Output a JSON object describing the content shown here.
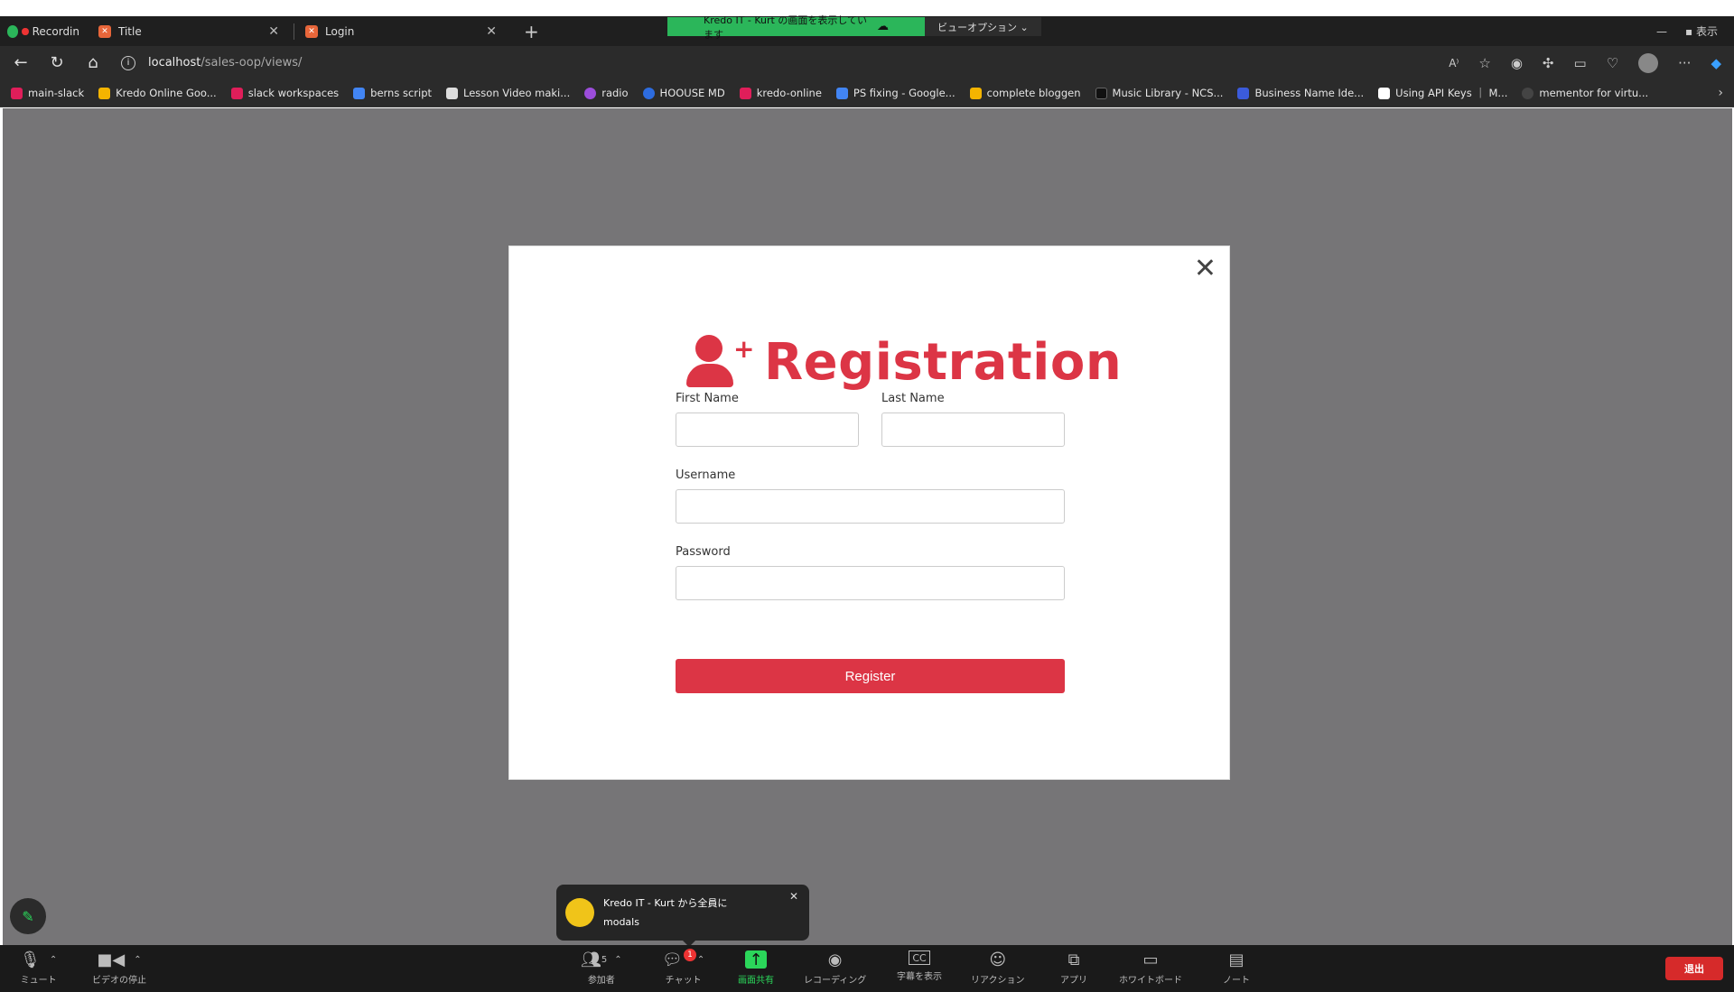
{
  "share_banner": {
    "message": "Kredo IT - Kurt の画面を表示しています",
    "view_options": "ビューオプション ⌄"
  },
  "tabs": [
    {
      "label": "Recordin",
      "active": false
    },
    {
      "label": "Title",
      "active": false
    },
    {
      "label": "Login",
      "active": true
    }
  ],
  "window": {
    "view_label": "表示"
  },
  "address": {
    "host": "localhost",
    "path": "/sales-oop/views/"
  },
  "bookmarks": [
    {
      "label": "main-slack",
      "color": "#e01e5a"
    },
    {
      "label": "Kredo Online  Goo...",
      "color": "#f4b400"
    },
    {
      "label": "slack workspaces",
      "color": "#e01e5a"
    },
    {
      "label": "berns script",
      "color": "#4285f4"
    },
    {
      "label": "Lesson Video maki...",
      "color": "#dddddd"
    },
    {
      "label": "radio",
      "color": "#9c4ddb"
    },
    {
      "label": "HOOUSE MD",
      "color": "#2d6cdf"
    },
    {
      "label": "kredo-online",
      "color": "#e01e5a"
    },
    {
      "label": "PS fixing - Google...",
      "color": "#4285f4"
    },
    {
      "label": "complete bloggen",
      "color": "#f4b400"
    },
    {
      "label": "Music Library - NCS...",
      "color": "#111111"
    },
    {
      "label": "Business Name Ide...",
      "color": "#3b5bdb"
    },
    {
      "label": "Using API Keys ｜ M...",
      "color": "#ffffff"
    },
    {
      "label": "mementor for virtu...",
      "color": "#444444"
    }
  ],
  "modal": {
    "title": "Registration",
    "fields": {
      "first_name": {
        "label": "First Name",
        "value": ""
      },
      "last_name": {
        "label": "Last Name",
        "value": ""
      },
      "username": {
        "label": "Username",
        "value": ""
      },
      "password": {
        "label": "Password",
        "value": ""
      }
    },
    "submit_label": "Register",
    "accent": "#dc3545"
  },
  "chat_popup": {
    "sender": "Kredo IT - Kurt から全員に",
    "message": "modals"
  },
  "zoom_toolbar": {
    "mute": "ミュート",
    "video": "ビデオの停止",
    "participants": "参加者",
    "participants_count": "5",
    "chat": "チャット",
    "chat_badge": "1",
    "share": "画面共有",
    "recording": "レコーディング",
    "captions": "字幕を表示",
    "reactions": "リアクション",
    "apps": "アプリ",
    "whiteboard": "ホワイトボード",
    "notes": "ノート",
    "leave": "退出"
  }
}
